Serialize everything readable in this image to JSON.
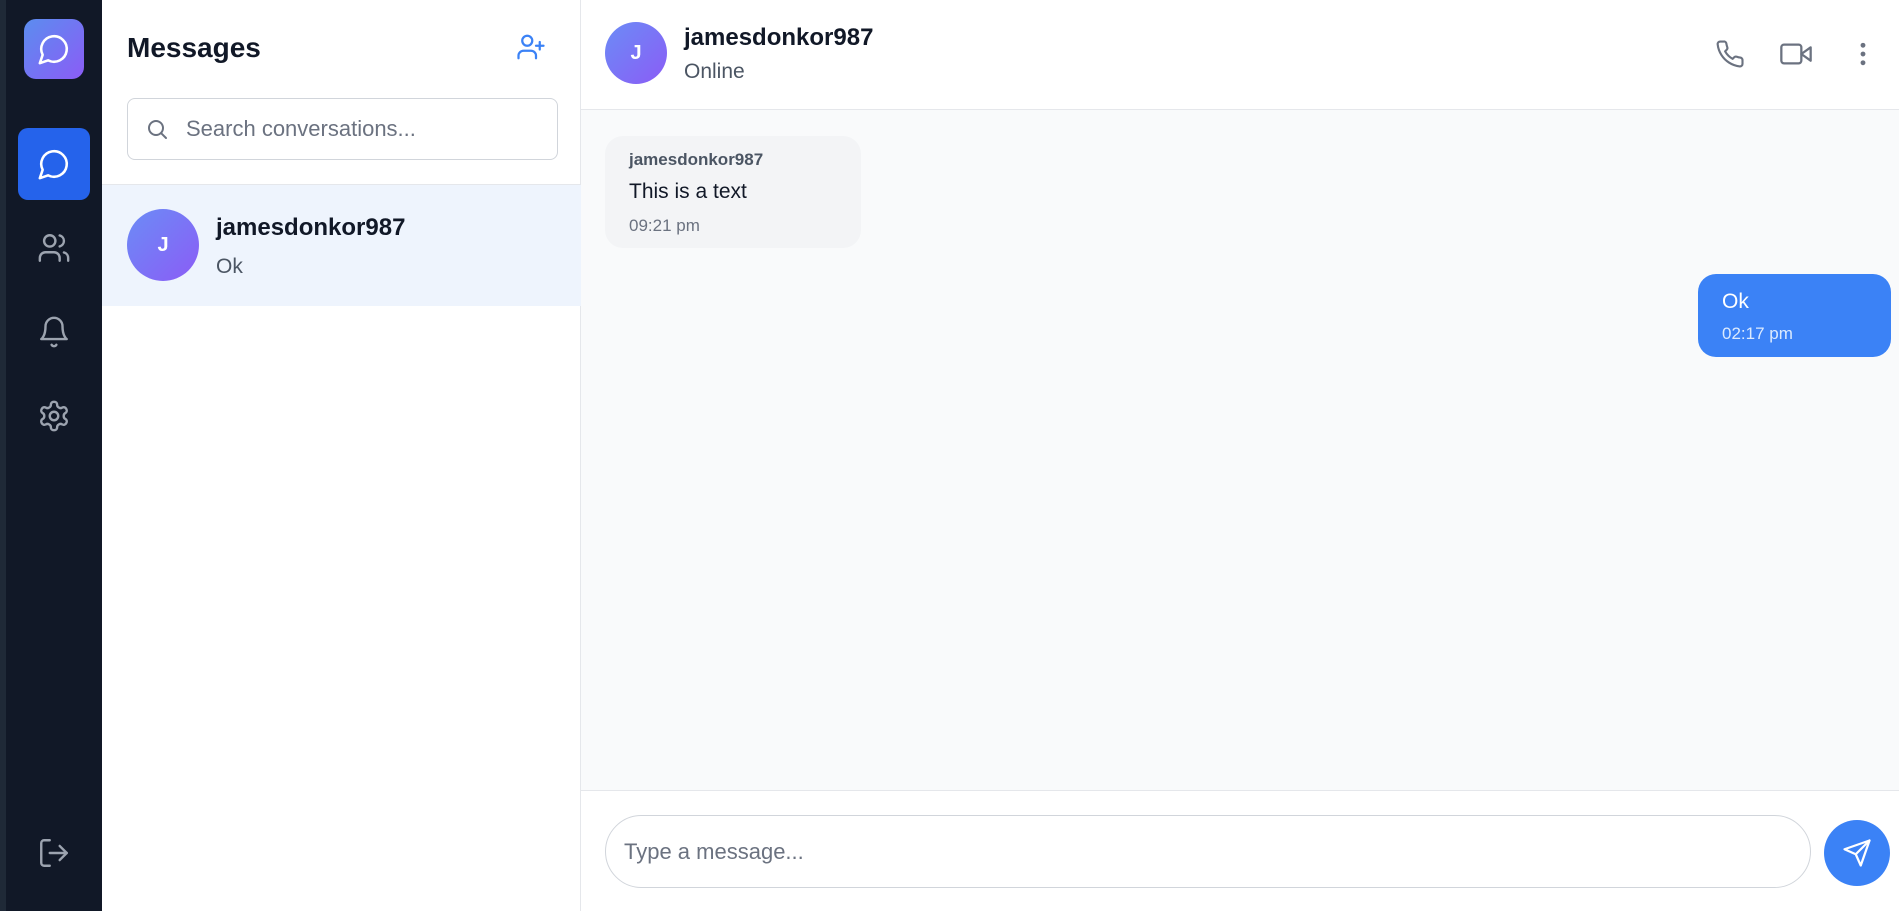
{
  "sidebar": {
    "items": [
      {
        "name": "messages",
        "icon": "chat-bubble-icon",
        "active": true
      },
      {
        "name": "contacts",
        "icon": "users-icon",
        "active": false
      },
      {
        "name": "notifications",
        "icon": "bell-icon",
        "active": false
      },
      {
        "name": "settings",
        "icon": "gear-icon",
        "active": false
      }
    ],
    "logout_icon": "logout-icon"
  },
  "conversations": {
    "title": "Messages",
    "search_placeholder": "Search conversations...",
    "items": [
      {
        "initial": "J",
        "name": "jamesdonkor987",
        "preview": "Ok",
        "selected": true
      }
    ]
  },
  "chat": {
    "contact": {
      "initial": "J",
      "name": "jamesdonkor987",
      "status": "Online"
    },
    "messages": [
      {
        "direction": "incoming",
        "sender": "jamesdonkor987",
        "text": "This is a text",
        "time": "09:21 pm"
      },
      {
        "direction": "outgoing",
        "text": "Ok",
        "time": "02:17 pm"
      }
    ],
    "composer_placeholder": "Type a message..."
  },
  "colors": {
    "rail_bg": "#111827",
    "accent": "#2563eb",
    "outgoing_bubble": "#3b82f6",
    "incoming_bubble": "#f3f4f6",
    "selected_row": "#eef4fd"
  }
}
